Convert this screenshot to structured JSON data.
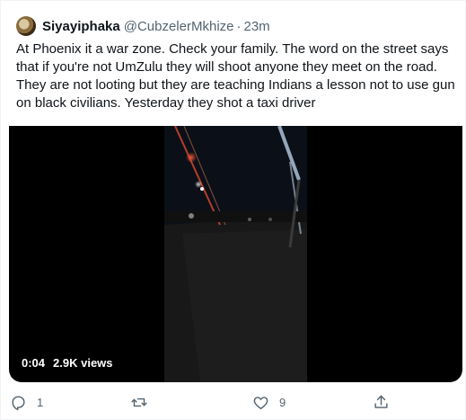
{
  "tweet": {
    "author_name": "Siyayiphaka",
    "author_handle": "@CubzelerMkhize",
    "separator": "·",
    "time": "23m",
    "text": "At Phoenix it a war zone. Check your family. The word on the street says that if you're not UmZulu they will shoot anyone they meet on the road. They are not looting but they are teaching Indians a lesson not to use gun on black civilians. Yesterday they shot a taxi driver"
  },
  "video": {
    "timestamp": "0:04",
    "views": "2.9K views"
  },
  "actions": {
    "reply_count": "1",
    "retweet_count": "",
    "like_count": "9",
    "reply_icon": "reply-icon",
    "retweet_icon": "retweet-icon",
    "like_icon": "heart-icon",
    "share_icon": "share-icon"
  },
  "colors": {
    "text_primary": "#0f1419",
    "text_secondary": "#536471",
    "media_background": "#000000",
    "border": "#eff3f4"
  }
}
